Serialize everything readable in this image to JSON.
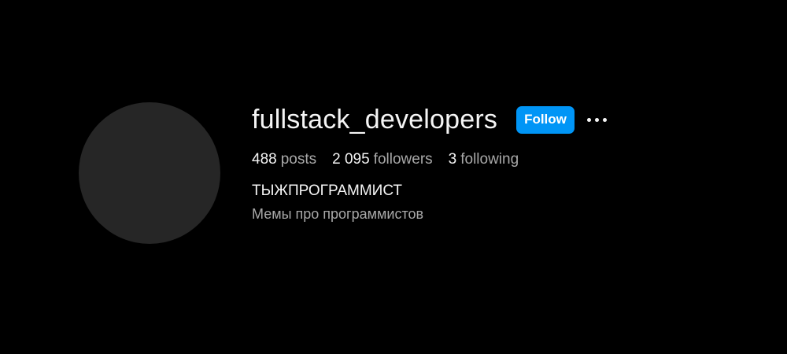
{
  "profile": {
    "username": "fullstack_developers",
    "follow_label": "Follow",
    "more_icon": "more-horizontal-icon",
    "full_name": "ТЫЖПРОГРАММИСТ",
    "bio": "Мемы про программистов"
  },
  "stats": {
    "posts": {
      "count": "488",
      "label": "posts"
    },
    "followers": {
      "count": "2 095",
      "label": "followers"
    },
    "following": {
      "count": "3",
      "label": "following"
    }
  },
  "colors": {
    "background": "#000000",
    "avatar_placeholder": "#262626",
    "accent": "#0095f6",
    "text_primary": "#f5f5f5",
    "text_secondary": "#a8a8a8"
  }
}
